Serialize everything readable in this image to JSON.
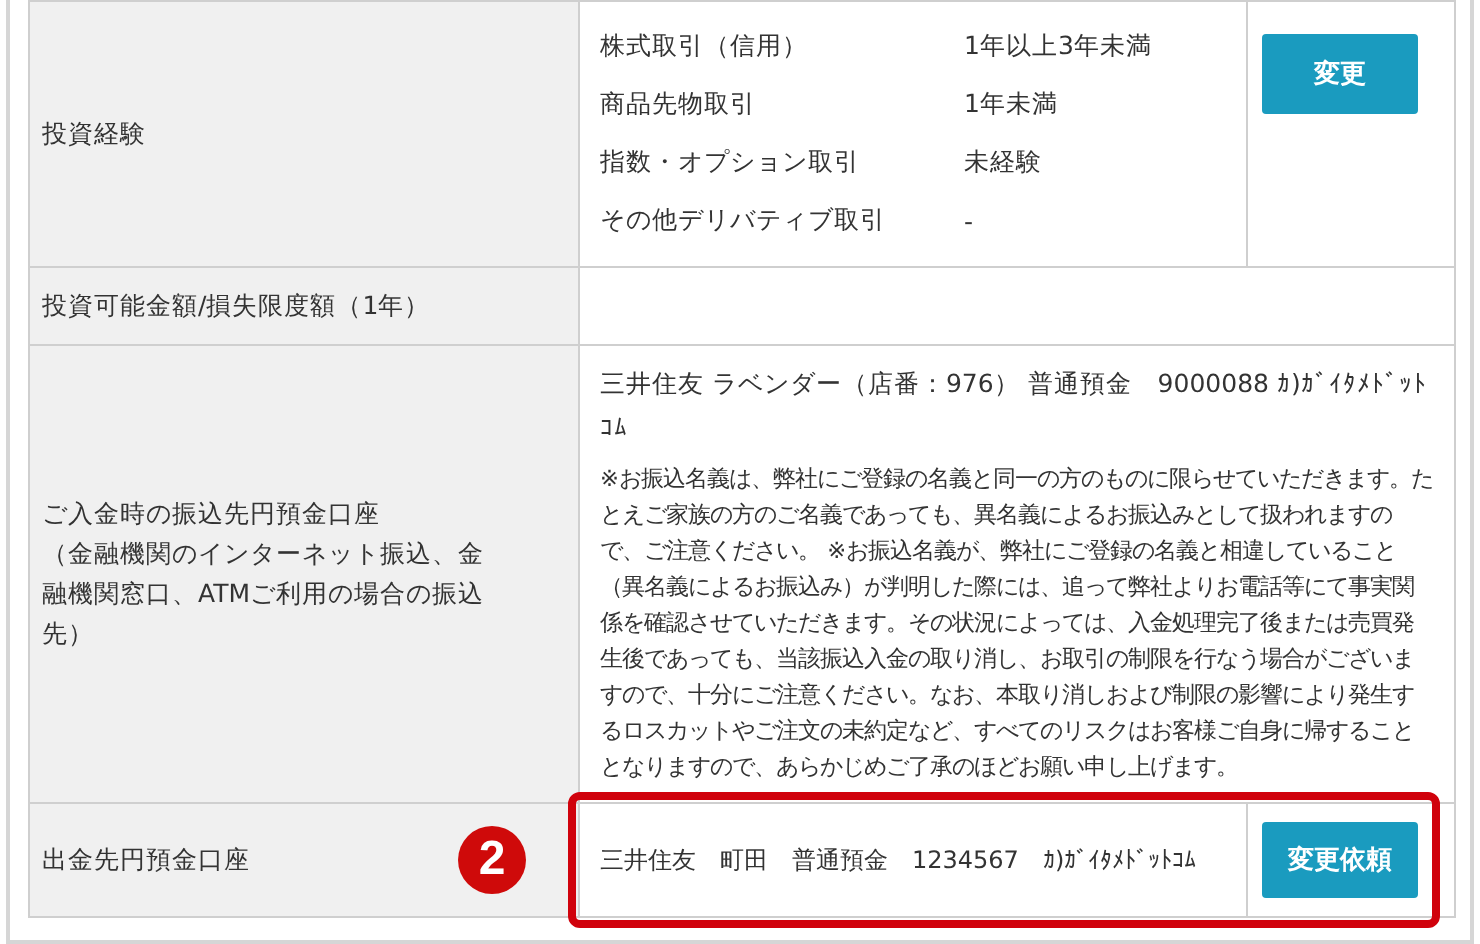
{
  "rows": [
    {
      "kind": "experience",
      "label": "投資経験",
      "items": [
        {
          "name": "株式取引（信用）",
          "value": "1年以上3年未満"
        },
        {
          "name": "商品先物取引",
          "value": "1年未満"
        },
        {
          "name": "指数・オプション取引",
          "value": "未経験"
        },
        {
          "name": "その他デリバティブ取引",
          "value": "-"
        }
      ],
      "button": "変更"
    },
    {
      "kind": "plain",
      "label": "投資可能金額/損失限度額（1年）"
    },
    {
      "kind": "deposit",
      "label": "ご入金時の振込先円預金口座",
      "sublabel": "（金融機関のインターネット振込、金融機関窓口、ATMご利用の場合の振込先）",
      "account": "三井住友 ラベンダー（店番：976） 普通預金　9000088 ｶ)ｶﾞｲﾀﾒﾄﾞｯﾄｺﾑ",
      "note": "※お振込名義は、弊社にご登録の名義と同一の方のものに限らせていただきます。たとえご家族の方のご名義であっても、異名義によるお振込みとして扱われますので、ご注意ください。 ※お振込名義が、弊社にご登録の名義と相違していること（異名義によるお振込み）が判明した際には、追って弊社よりお電話等にて事実関係を確認させていただきます。その状況によっては、入金処理完了後または売買発生後であっても、当該振込入金の取り消し、お取引の制限を行なう場合がございますので、十分にご注意ください。なお、本取り消しおよび制限の影響により発生するロスカットやご注文の未約定など、すべてのリスクはお客様ご自身に帰することとなりますので、あらかじめご了承のほどお願い申し上げます。"
    },
    {
      "kind": "withdraw",
      "label": "出金先円預金口座",
      "account": "三井住友　町田　普通預金　1234567　ｶ)ｶﾞｲﾀﾒﾄﾞｯﾄｺﾑ",
      "button": "変更依頼",
      "highlighted": true,
      "badge": "2"
    }
  ]
}
